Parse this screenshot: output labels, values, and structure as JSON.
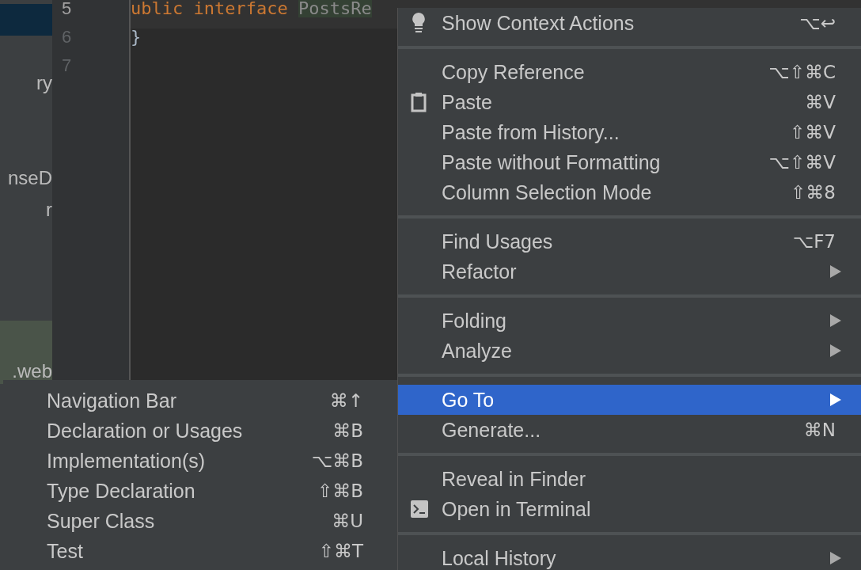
{
  "project_tree": {
    "items": [
      {
        "label": "ry",
        "highlighted": false
      },
      {
        "label": "nseD",
        "highlighted": false
      },
      {
        "label": "r",
        "highlighted": false
      },
      {
        "label": ".web",
        "highlighted": true
      }
    ]
  },
  "editor": {
    "lines": [
      {
        "number": "5",
        "current": true,
        "tokens": [
          {
            "kind": "keyword",
            "text": "ublic interface "
          },
          {
            "kind": "identifier",
            "text": "PostsRe"
          }
        ]
      },
      {
        "number": "6",
        "current": false,
        "tokens": [
          {
            "kind": "brace",
            "text": "}"
          }
        ]
      },
      {
        "number": "7",
        "current": false
      }
    ]
  },
  "context_menu": {
    "groups": [
      [
        {
          "label": "Show Context Actions",
          "shortcut": "⌥↩",
          "kind": "lightbulb",
          "has_submenu": false,
          "selected": false
        }
      ],
      [
        {
          "label": "Copy Reference",
          "shortcut": "⌥⇧⌘C",
          "kind": "plain",
          "has_submenu": false,
          "selected": false
        },
        {
          "label": "Paste",
          "shortcut": "⌘V",
          "kind": "clipboard",
          "has_submenu": false,
          "selected": false
        },
        {
          "label": "Paste from History...",
          "shortcut": "⇧⌘V",
          "kind": "plain",
          "has_submenu": false,
          "selected": false
        },
        {
          "label": "Paste without Formatting",
          "shortcut": "⌥⇧⌘V",
          "kind": "plain",
          "has_submenu": false,
          "selected": false
        },
        {
          "label": "Column Selection Mode",
          "shortcut": "⇧⌘8",
          "kind": "plain",
          "has_submenu": false,
          "selected": false
        }
      ],
      [
        {
          "label": "Find Usages",
          "shortcut": "⌥F7",
          "kind": "plain",
          "has_submenu": false,
          "selected": false
        },
        {
          "label": "Refactor",
          "kind": "plain",
          "has_submenu": true,
          "selected": false
        }
      ],
      [
        {
          "label": "Folding",
          "kind": "plain",
          "has_submenu": true,
          "selected": false
        },
        {
          "label": "Analyze",
          "kind": "plain",
          "has_submenu": true,
          "selected": false
        }
      ],
      [
        {
          "label": "Go To",
          "kind": "plain",
          "has_submenu": true,
          "selected": true
        },
        {
          "label": "Generate...",
          "shortcut": "⌘N",
          "kind": "plain",
          "has_submenu": false,
          "selected": false
        }
      ],
      [
        {
          "label": "Reveal in Finder",
          "kind": "plain",
          "has_submenu": false,
          "selected": false
        },
        {
          "label": "Open in Terminal",
          "kind": "terminal",
          "has_submenu": false,
          "selected": false
        }
      ],
      [
        {
          "label": "Local History",
          "kind": "plain",
          "has_submenu": true,
          "selected": false
        }
      ]
    ]
  },
  "submenu": {
    "items": [
      {
        "label": "Navigation Bar",
        "shortcut": "⌘↑",
        "selected": false
      },
      {
        "label": "Declaration or Usages",
        "shortcut": "⌘B",
        "selected": false
      },
      {
        "label": "Implementation(s)",
        "shortcut": "⌥⌘B",
        "selected": false
      },
      {
        "label": "Type Declaration",
        "shortcut": "⇧⌘B",
        "selected": false
      },
      {
        "label": "Super Class",
        "shortcut": "⌘U",
        "selected": false
      },
      {
        "label": "Test",
        "shortcut": "⇧⌘T",
        "selected": false
      }
    ]
  }
}
